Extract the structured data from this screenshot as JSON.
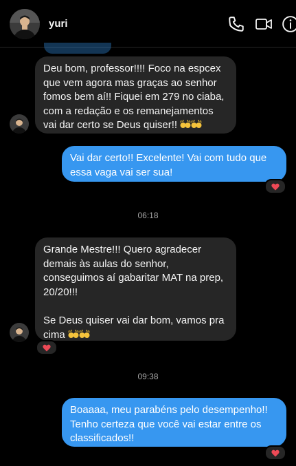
{
  "header": {
    "contact_name": "yuri",
    "icons": [
      "phone-icon",
      "video-camera-icon",
      "info-icon"
    ]
  },
  "messages": [
    {
      "direction": "incoming",
      "text": "Deu bom, professor!!!! Foco na espcex que vem agora mas graças ao senhor fomos bem aí!! Fiquei em 279 no ciaba, com a redação e os remanejamentos vai dar certo se Deus quiser!!",
      "emoji": "raising-hands-emoji"
    },
    {
      "direction": "outgoing",
      "text": "Vai dar certo!! Excelente! Vai com tudo que essa vaga vai ser sua!",
      "reaction": "red-heart"
    },
    {
      "timestamp": "06:18"
    },
    {
      "direction": "incoming",
      "text": "Grande Mestre!!! Quero agradecer demais às aulas do senhor, conseguimos aí gabaritar MAT na prep, 20/20!!!\n\nSe Deus quiser vai dar bom, vamos pra cima",
      "emoji": "raising-hands-emoji",
      "reaction": "red-heart"
    },
    {
      "timestamp": "09:38"
    },
    {
      "direction": "outgoing",
      "text": "Boaaaa, meu parabéns pelo desempenho!! Tenho certeza que você vai estar entre os classificados!!",
      "reaction": "red-heart"
    }
  ],
  "colors": {
    "background": "#000000",
    "incoming_bubble": "#262626",
    "outgoing_bubble": "#3797f0",
    "timestamp_text": "#a8a8a8",
    "heart": "#ed4956"
  }
}
